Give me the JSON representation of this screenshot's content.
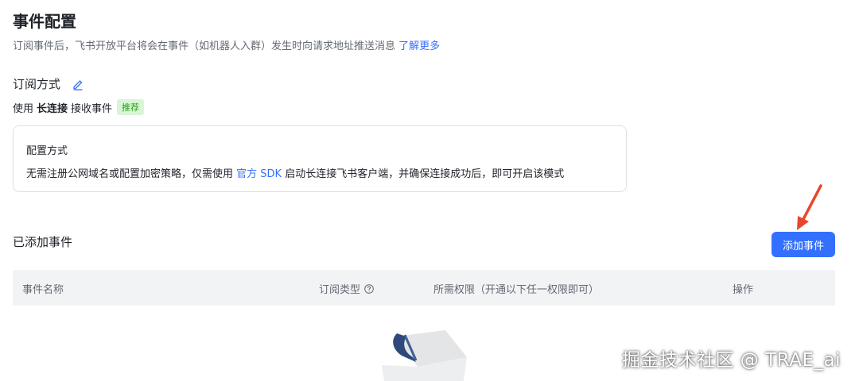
{
  "header": {
    "title": "事件配置",
    "description": "订阅事件后，飞书开放平台将会在事件（如机器人入群）发生时向请求地址推送消息",
    "learn_more": "了解更多"
  },
  "subscription": {
    "title": "订阅方式",
    "edit_icon": "edit-icon",
    "prefix": "使用",
    "method": "长连接",
    "suffix": "接收事件",
    "badge": "推荐"
  },
  "config_card": {
    "title": "配置方式",
    "desc_before": "无需注册公网域名或配置加密策略，仅需使用",
    "sdk_link": "官方 SDK",
    "desc_after": "启动长连接飞书客户端，并确保连接成功后，即可开启该模式"
  },
  "events": {
    "title": "已添加事件",
    "add_button": "添加事件",
    "columns": [
      "事件名称",
      "订阅类型",
      "所需权限（开通以下任一权限即可）",
      "操作"
    ]
  },
  "watermark": "掘金技术社区 @ TRAE_ai",
  "colors": {
    "primary": "#3370ff",
    "annotation_arrow": "#e8452c",
    "badge_bg": "#d9f5d6",
    "badge_text": "#2ea121"
  }
}
